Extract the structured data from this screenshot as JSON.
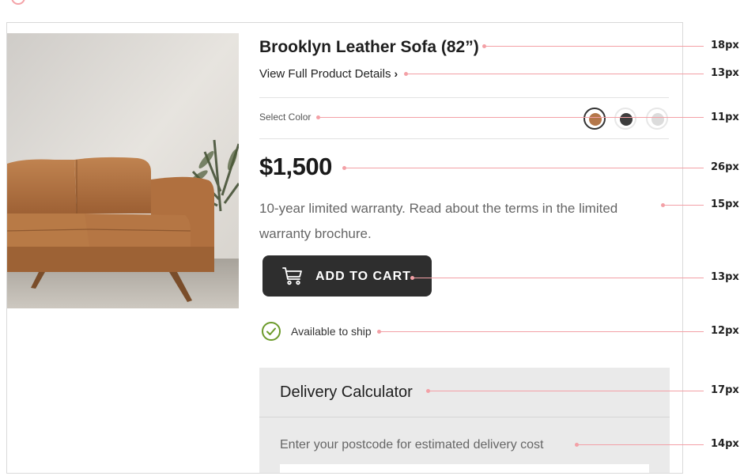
{
  "product": {
    "title": "Brooklyn Leather Sofa (82”)",
    "details_link": "View Full Product Details",
    "details_chevron": "›",
    "select_color_label": "Select Color",
    "price": "$1,500",
    "warranty_text": "10-year limited warranty. Read about the terms in the limited warranty brochure.",
    "add_to_cart_label": "ADD TO CART",
    "availability": "Available to ship",
    "colors": [
      {
        "name": "tan",
        "hex": "#b4774a",
        "selected": true
      },
      {
        "name": "charcoal",
        "hex": "#3d3d3d",
        "selected": false
      },
      {
        "name": "light-grey",
        "hex": "#dcdcdc",
        "selected": false
      }
    ]
  },
  "delivery_calculator": {
    "title": "Delivery Calculator",
    "hint": "Enter your postcode for estimated delivery cost",
    "postcode_value": ""
  },
  "annotations": {
    "title_size": "18px",
    "link_size": "13px",
    "select_color_size": "11px",
    "price_size": "26px",
    "warranty_size": "15px",
    "button_size": "13px",
    "availability_size": "12px",
    "calc_title_size": "17px",
    "calc_hint_size": "14px"
  },
  "colors": {
    "button_bg": "#2e2e2e",
    "check_green": "#6b9a2a",
    "guide_pink": "#f3a0a6",
    "calc_bg": "#eaeaea"
  }
}
